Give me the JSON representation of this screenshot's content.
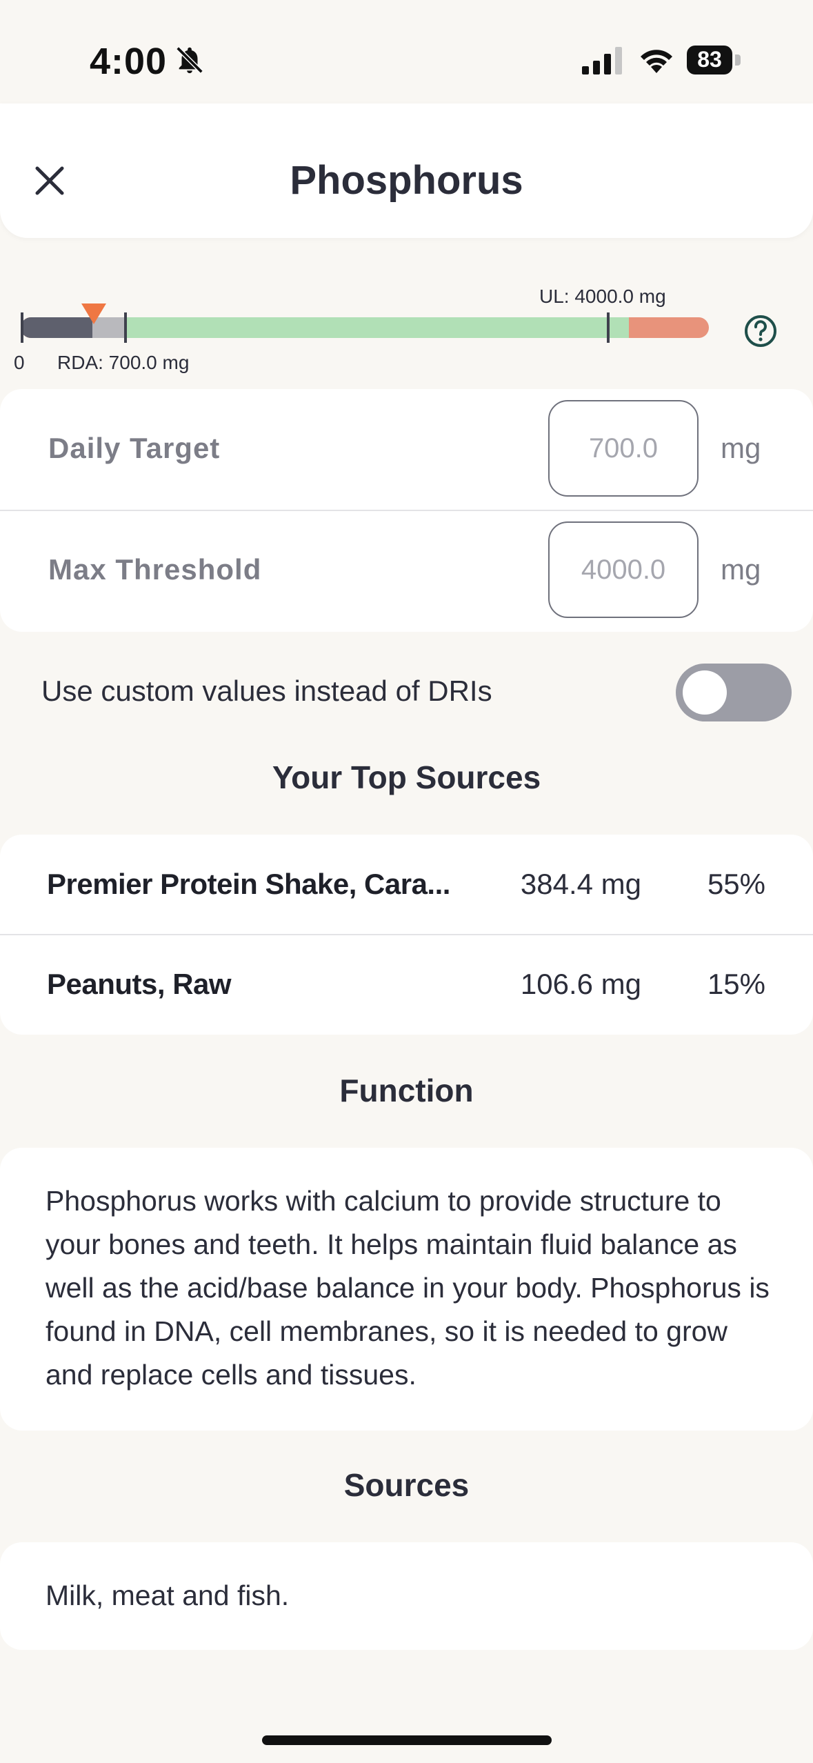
{
  "status_bar": {
    "time": "4:00",
    "battery": "83",
    "icons": [
      "bell-slash-icon",
      "cellular-signal-icon",
      "wifi-icon",
      "battery-icon"
    ]
  },
  "header": {
    "title": "Phosphorus",
    "close_icon": "close-icon"
  },
  "range_bar": {
    "ul_label": "UL: 4000.0 mg",
    "zero_label": "0",
    "rda_label": "RDA: 700.0 mg",
    "help_icon": "question-circle-icon",
    "colors": {
      "consumed": "#5e606d",
      "below_rda": "#b9b9bd",
      "safe": "#b1e0b6",
      "over_ul": "#e8937b",
      "marker": "#ef7743"
    }
  },
  "thresholds": {
    "daily_target": {
      "label": "Daily Target",
      "value": "700.0",
      "unit": "mg"
    },
    "max_threshold": {
      "label": "Max Threshold",
      "value": "4000.0",
      "unit": "mg"
    }
  },
  "custom_values": {
    "label": "Use custom values instead of DRIs",
    "enabled": false
  },
  "top_sources": {
    "title": "Your Top Sources",
    "items": [
      {
        "name": "Premier Protein Shake, Cara...",
        "amount": "384.4 mg",
        "percent": "55%"
      },
      {
        "name": "Peanuts, Raw",
        "amount": "106.6 mg",
        "percent": "15%"
      }
    ]
  },
  "function": {
    "title": "Function",
    "text": "Phosphorus works with calcium to provide structure to your bones and teeth. It helps maintain fluid balance as well as the acid/base balance in your body. Phosphorus is found in DNA, cell membranes, so it is needed to grow and replace cells and tissues."
  },
  "sources": {
    "title": "Sources",
    "text": "Milk, meat and fish."
  }
}
